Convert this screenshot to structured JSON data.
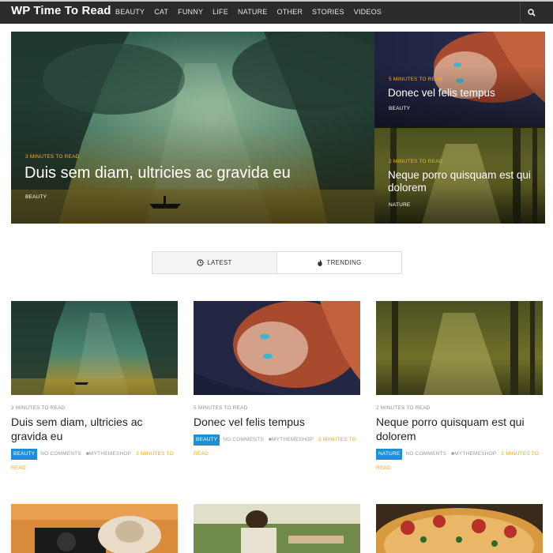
{
  "site": {
    "logo": "WP Time To Read"
  },
  "nav": {
    "items": [
      "BEAUTY",
      "CAT",
      "FUNNY",
      "LIFE",
      "NATURE",
      "OTHER",
      "STORIES",
      "VIDEOS"
    ]
  },
  "hero": {
    "main": {
      "read_time": "3 MINUTES TO READ",
      "title": "Duis sem diam, ultricies ac gravida eu",
      "category": "BEAUTY"
    },
    "side_top": {
      "read_time": "5 MINUTES TO READ",
      "title": "Donec vel felis tempus",
      "category": "BEAUTY"
    },
    "side_bottom": {
      "read_time": "2 MINUTES TO READ",
      "title": "Neque porro quisquam est qui dolorem",
      "category": "NATURE"
    }
  },
  "tabs": {
    "latest": "LATEST",
    "trending": "TRENDING"
  },
  "cards": [
    {
      "read_time": "3 MINUTES TO READ",
      "title": "Duis sem diam, ultricies ac gravida eu",
      "category": "BEAUTY",
      "comments": "NO COMMENTS",
      "author": "MYTHEMESHOP",
      "read_label": "3 MINUTES TO READ"
    },
    {
      "read_time": "5 MINUTES TO READ",
      "title": "Donec vel felis tempus",
      "category": "BEAUTY",
      "comments": "NO COMMENTS",
      "author": "MYTHEMESHOP",
      "read_label": "5 MINUTES TO READ"
    },
    {
      "read_time": "2 MINUTES TO READ",
      "title": "Neque porro quisquam est qui dolorem",
      "category": "NATURE",
      "comments": "NO COMMENTS",
      "author": "MYTHEMESHOP",
      "read_label": "2 MINUTES TO READ"
    }
  ],
  "colors": {
    "nav_bg": "#2b2b2b",
    "accent_yellow": "#f4b400",
    "badge_blue": "#1e8fd6"
  }
}
